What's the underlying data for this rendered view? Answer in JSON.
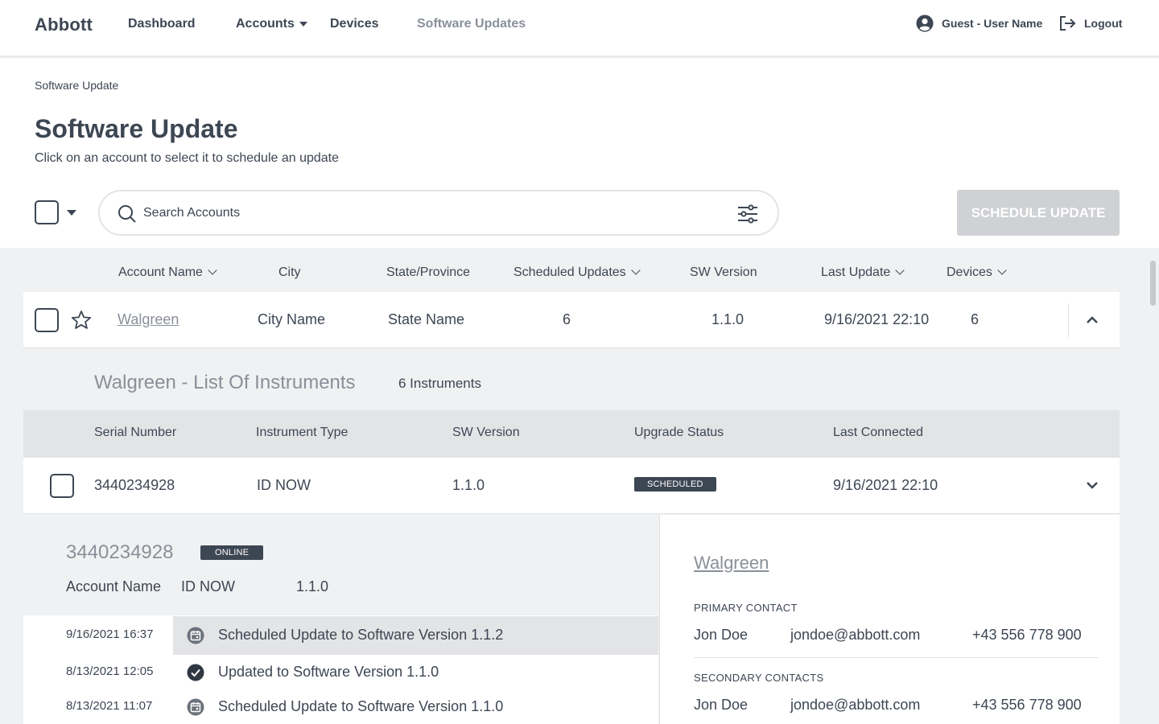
{
  "nav": {
    "brand": "Abbott",
    "links": [
      "Dashboard",
      "Accounts",
      "Devices",
      "Software Updates"
    ],
    "user": "Guest - User Name",
    "logout": "Logout"
  },
  "page": {
    "breadcrumb": "Software Update",
    "title": "Software Update",
    "subtitle": "Click on an account to select it to schedule an update",
    "search_placeholder": "Search Accounts",
    "schedule_button": "SCHEDULE UPDATE"
  },
  "accounts_table": {
    "columns": [
      "Account Name",
      "City",
      "State/Province",
      "Scheduled Updates",
      "SW Version",
      "Last Update",
      "Devices"
    ],
    "row": {
      "name": "Walgreen",
      "city": "City Name",
      "state": "State Name",
      "scheduled_updates": "6",
      "sw_version": "1.1.0",
      "last_update": "9/16/2021 22:10",
      "devices": "6"
    }
  },
  "instruments": {
    "title": "Walgreen - List Of Instruments",
    "count": "6 Instruments",
    "columns": [
      "Serial Number",
      "Instrument Type",
      "SW Version",
      "Upgrade Status",
      "Last Connected"
    ],
    "row": {
      "serial": "3440234928",
      "type": "ID NOW",
      "sw_version": "1.1.0",
      "status": "SCHEDULED",
      "last_connected": "9/16/2021 22:10"
    }
  },
  "detail": {
    "serial": "3440234928",
    "status": "ONLINE",
    "account_label": "Account Name",
    "type": "ID NOW",
    "version": "1.1.0",
    "history": [
      {
        "date": "9/16/2021 16:37",
        "text": "Scheduled Update to Software Version 1.1.2",
        "icon": "calendar-icon"
      },
      {
        "date": "8/13/2021 12:05",
        "text": "Updated to Software Version 1.1.0",
        "icon": "check-circle-icon"
      },
      {
        "date": "8/13/2021 11:07",
        "text": "Scheduled Update to Software Version 1.1.0",
        "icon": "calendar-icon"
      }
    ],
    "account_name": "Walgreen",
    "primary_label": "PRIMARY CONTACT",
    "primary": {
      "name": "Jon Doe",
      "email": "jondoe@abbott.com",
      "phone": "+43 556 778 900"
    },
    "secondary_label": "SECONDARY CONTACTS",
    "secondary": {
      "name": "Jon Doe",
      "email": "jondoe@abbott.com",
      "phone": "+43 556 778 900"
    }
  }
}
